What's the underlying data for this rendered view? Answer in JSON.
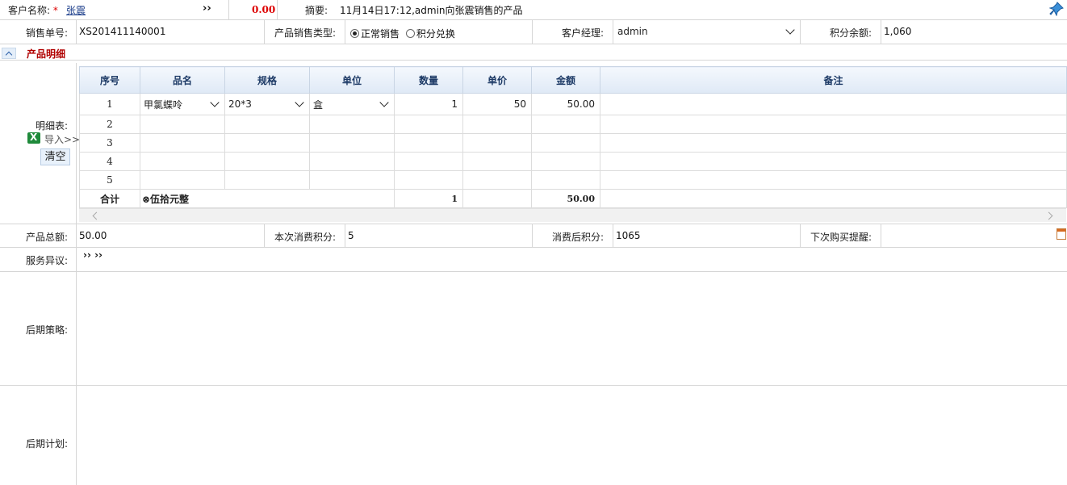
{
  "row1": {
    "customer_label": "客户名称:",
    "required_mark": "*",
    "customer_name": "张震",
    "arrow": "››",
    "amount": "0.00",
    "summary_label": "摘要:",
    "summary_value": "11月14日17:12,admin向张震销售的产品"
  },
  "row2": {
    "sale_no_label": "销售单号:",
    "sale_no_value": "XS201411140001",
    "sale_type_label": "产品销售类型:",
    "sale_type_options": [
      "正常销售",
      "积分兑换"
    ],
    "sale_type_selected": "正常销售",
    "manager_label": "客户经理:",
    "manager_value": "admin",
    "points_label": "积分余额:",
    "points_value": "1,060"
  },
  "section": {
    "title": "产品明细"
  },
  "detail": {
    "label": "明细表:",
    "import_label": "导入>>",
    "clear_label": "清空",
    "columns": [
      "序号",
      "品名",
      "规格",
      "单位",
      "数量",
      "单价",
      "金额",
      "备注"
    ],
    "rows": [
      {
        "no": "1",
        "name": "甲氯蝶呤",
        "spec": "20*3",
        "unit": "盒",
        "qty": "1",
        "price": "50",
        "amount": "50.00",
        "note": ""
      },
      {
        "no": "2",
        "name": "",
        "spec": "",
        "unit": "",
        "qty": "",
        "price": "",
        "amount": "",
        "note": ""
      },
      {
        "no": "3",
        "name": "",
        "spec": "",
        "unit": "",
        "qty": "",
        "price": "",
        "amount": "",
        "note": ""
      },
      {
        "no": "4",
        "name": "",
        "spec": "",
        "unit": "",
        "qty": "",
        "price": "",
        "amount": "",
        "note": ""
      },
      {
        "no": "5",
        "name": "",
        "spec": "",
        "unit": "",
        "qty": "",
        "price": "",
        "amount": "",
        "note": ""
      }
    ],
    "total": {
      "label": "合计",
      "words": "⊗伍拾元整",
      "qty": "1",
      "amount": "50.00"
    }
  },
  "row3": {
    "total_label": "产品总额:",
    "total_value": "50.00",
    "consume_points_label": "本次消费积分:",
    "consume_points_value": "5",
    "after_points_label": "消费后积分:",
    "after_points_value": "1065",
    "reminder_label": "下次购买提醒:",
    "reminder_value": ""
  },
  "service": {
    "label": "服务异议:",
    "value": "›› ››"
  },
  "strategy": {
    "label": "后期策略:"
  },
  "plan": {
    "label": "后期计划:"
  },
  "icons": {
    "pin": "pin-icon",
    "calendar": "calendar-icon",
    "excel": "excel-icon",
    "collapse": "collapse-up-icon"
  }
}
